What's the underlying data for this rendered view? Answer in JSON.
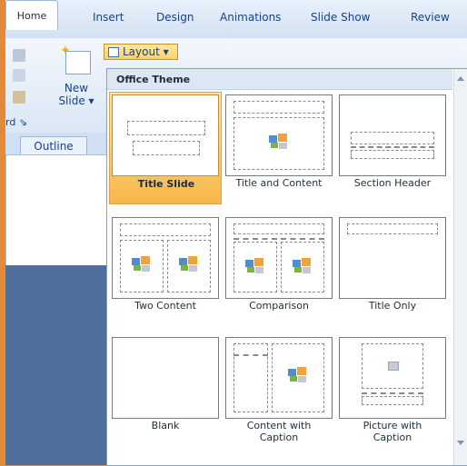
{
  "ribbon": {
    "tabs": [
      "Home",
      "Insert",
      "Design",
      "Animations",
      "Slide Show",
      "Review"
    ],
    "active_tab": "Home",
    "new_slide_label_1": "New",
    "new_slide_label_2": "Slide ▾",
    "layout_button_label": "Layout ▾",
    "clipboard_group_label": "rd ⇘",
    "outline_tab_label": "Outline"
  },
  "gallery": {
    "title": "Office Theme",
    "selected": "Title Slide",
    "layouts": [
      {
        "label": "Title Slide"
      },
      {
        "label": "Title and Content"
      },
      {
        "label": "Section Header"
      },
      {
        "label": "Two Content"
      },
      {
        "label": "Comparison"
      },
      {
        "label": "Title Only"
      },
      {
        "label": "Blank"
      },
      {
        "label_1": "Content with",
        "label_2": "Caption"
      },
      {
        "label_1": "Picture with",
        "label_2": "Caption"
      }
    ]
  },
  "colors": {
    "selection": "#f7b64a",
    "ribbon_text": "#15428b",
    "background_frame": "#e3893a"
  },
  "icons": [
    "cut-icon",
    "copy-icon",
    "format-painter-icon",
    "layout-icon",
    "scroll-up-icon",
    "scroll-down-icon",
    "picture-placeholder-icon"
  ]
}
